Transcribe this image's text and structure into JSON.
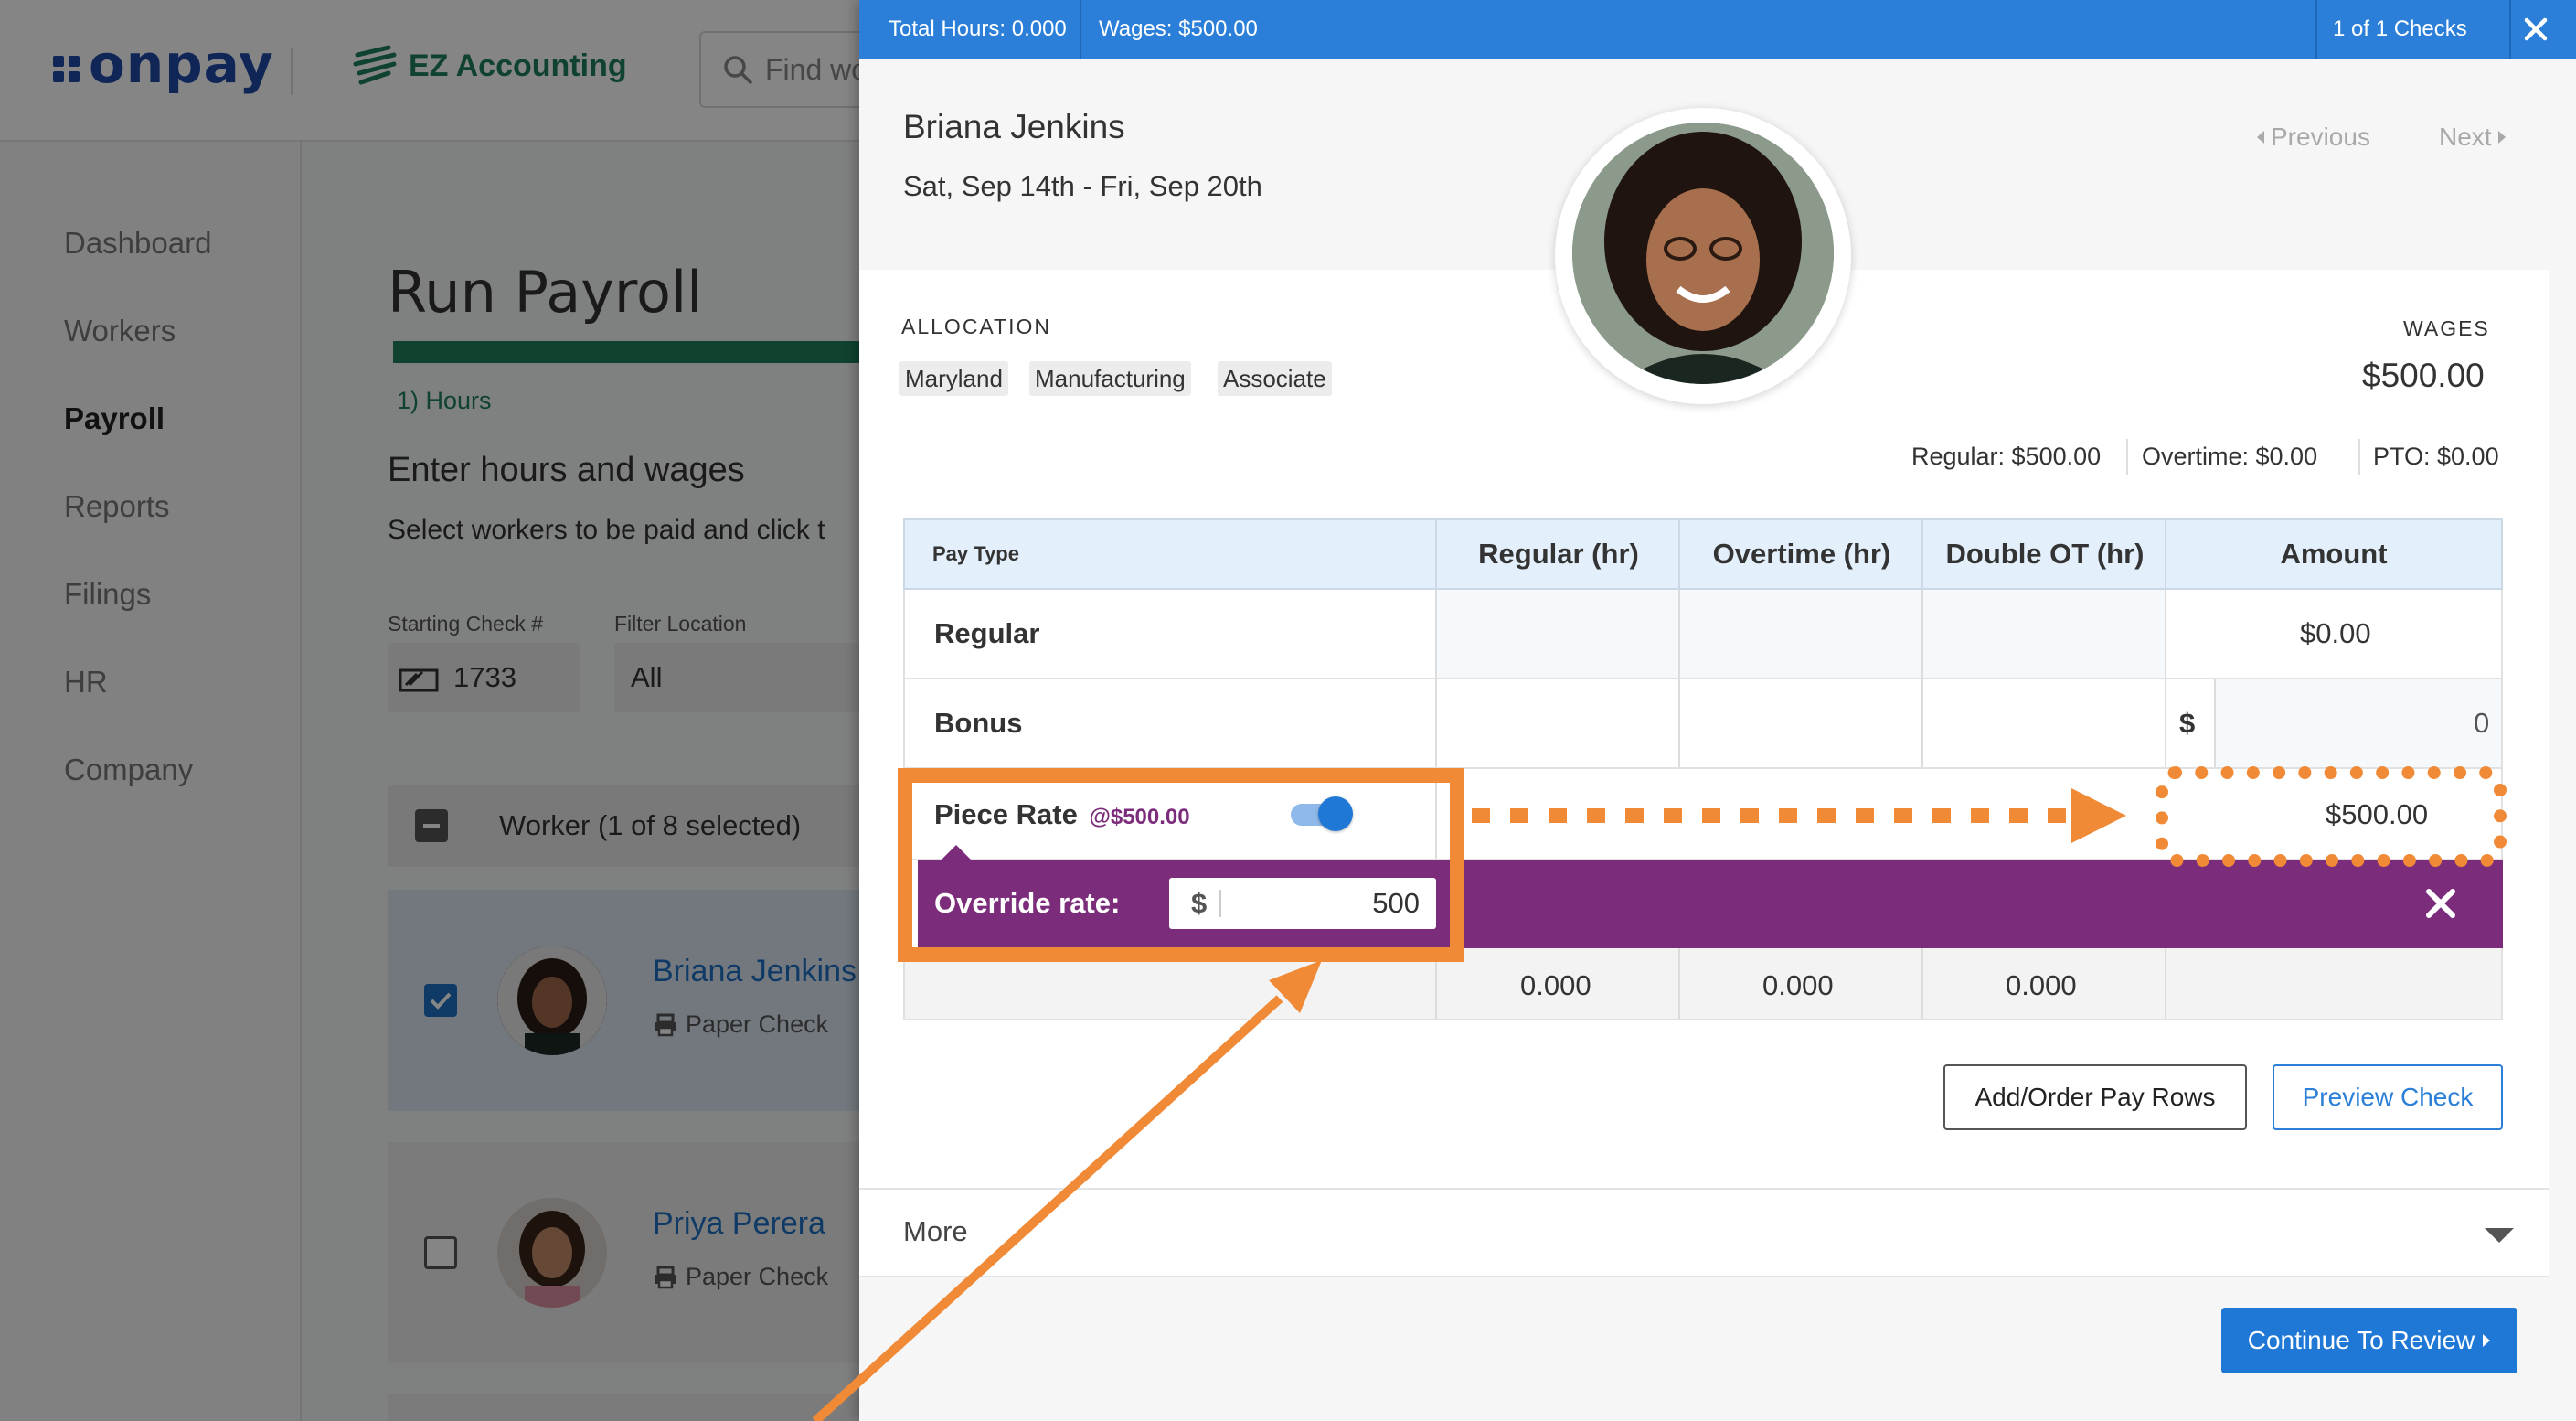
{
  "brand": {
    "name": "onpay",
    "integration": "EZ Accounting"
  },
  "search": {
    "placeholder": "Find wo"
  },
  "sidebar": {
    "items": [
      {
        "label": "Dashboard",
        "active": false
      },
      {
        "label": "Workers",
        "active": false
      },
      {
        "label": "Payroll",
        "active": true
      },
      {
        "label": "Reports",
        "active": false
      },
      {
        "label": "Filings",
        "active": false
      },
      {
        "label": "HR",
        "active": false
      },
      {
        "label": "Company",
        "active": false
      }
    ]
  },
  "main": {
    "title": "Run Payroll",
    "step": "1) Hours",
    "section_title": "Enter hours and wages",
    "section_subtitle": "Select workers to be paid and click t",
    "starting_check": {
      "label": "Starting Check #",
      "value": "1733"
    },
    "filter_location": {
      "label": "Filter Location",
      "value": "All"
    },
    "worker_header": "Worker (1 of 8 selected)",
    "workers": [
      {
        "name": "Briana Jenkins",
        "method": "Paper Check",
        "selected": true
      },
      {
        "name": "Priya Perera",
        "method": "Paper Check",
        "selected": false
      }
    ]
  },
  "modal": {
    "top_bar": {
      "total_hours": "Total Hours: 0.000",
      "wages": "Wages: $500.00",
      "check_count": "1 of 1 Checks"
    },
    "employee": {
      "name": "Briana Jenkins",
      "period": "Sat, Sep 14th - Fri, Sep 20th"
    },
    "nav": {
      "previous": "Previous",
      "next": "Next"
    },
    "allocation": {
      "label": "ALLOCATION",
      "chips": [
        "Maryland",
        "Manufacturing",
        "Associate"
      ]
    },
    "wages": {
      "label": "WAGES",
      "total": "$500.00",
      "regular": "Regular: $500.00",
      "overtime": "Overtime: $0.00",
      "pto": "PTO: $0.00"
    },
    "table": {
      "columns": [
        "Pay Type",
        "Regular (hr)",
        "Overtime (hr)",
        "Double OT (hr)",
        "Amount"
      ],
      "rows": {
        "regular": {
          "label": "Regular",
          "amount": "$0.00"
        },
        "bonus": {
          "label": "Bonus",
          "currency": "$",
          "amount": "0"
        },
        "piece_rate": {
          "label": "Piece Rate",
          "rate": "@$500.00",
          "amount": "$500.00",
          "toggle_on": true
        }
      },
      "override": {
        "label": "Override rate:",
        "currency": "$",
        "value": "500"
      },
      "totals": [
        "0.000",
        "0.000",
        "0.000"
      ]
    },
    "buttons": {
      "add_order": "Add/Order Pay Rows",
      "preview": "Preview Check",
      "continue": "Continue To Review"
    },
    "more": {
      "label": "More"
    }
  },
  "colors": {
    "brand_blue": "#1f4aa8",
    "modal_bar": "#2b7fd8",
    "override_purple": "#7b2d7b",
    "annotation_orange": "#f08a36",
    "accent_green": "#1e7f5b"
  }
}
